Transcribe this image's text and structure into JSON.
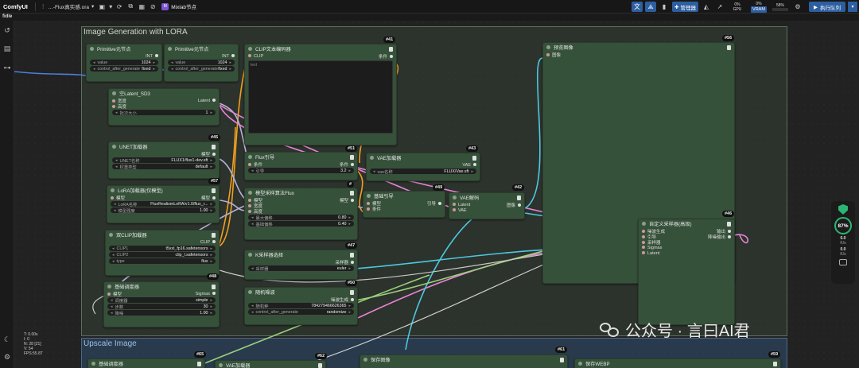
{
  "app": {
    "name": "ComfyUI",
    "workflow_name": "…-Flux真实感.ora",
    "tab_label": "Mixlab节点",
    "subtitle": "fidle"
  },
  "toolbar": {
    "manager_label": "管理器",
    "gpu_label": "GPU",
    "gpu_value": "0%",
    "vram_label": "VRAM",
    "vram_value": "58%",
    "cpu_value": "0%",
    "queue_label": "执行队列"
  },
  "stats": [
    "T: 0.00s",
    "I: 0",
    "N: 28 [21]",
    "V: 54",
    "FPS:55.87"
  ],
  "groups": {
    "main": {
      "title": "Image Generation with LORA"
    },
    "upscale": {
      "title": "Upscale Image"
    }
  },
  "nodes": {
    "primitive1": {
      "title": "Primitive元节点",
      "out": "INT",
      "value_label": "value",
      "value": "1024",
      "cag_label": "control_after_generate",
      "cag_value": "fixed"
    },
    "primitive2": {
      "title": "Primitive元节点",
      "out": "INT",
      "value_label": "value",
      "value": "1024",
      "cag_label": "control_after_generate",
      "cag_value": "fixed"
    },
    "clip_text": {
      "title": "CLIP文本编码器",
      "badge": "#41",
      "in": "CLIP",
      "out": "条件",
      "text": "text"
    },
    "latent": {
      "title": "空Latent_SD3",
      "badge": "#",
      "in1": "宽度",
      "in2": "高度",
      "out": "Latent",
      "w_label": "批次大小",
      "w_value": "1"
    },
    "unet": {
      "title": "UNET加载器",
      "badge": "#45",
      "out": "模型",
      "w1_label": "UNET名称",
      "w1_value": "FLUX1/flux1-dev.sft",
      "w2_label": "权重类型",
      "w2_value": "default"
    },
    "lora": {
      "title": "LoRA加载器(仅模型)",
      "badge": "#57",
      "in": "模型",
      "out": "模型",
      "w1_label": "LoRA名称",
      "w1_value": "FluxRealismLoRA/v1.0/flux_r...",
      "w2_label": "模型强度",
      "w2_value": "1.00"
    },
    "dualclip": {
      "title": "双CLIP加载器",
      "badge": "#48",
      "out": "CLIP",
      "w1_label": "CLIP1",
      "w1_value": "t5xxl_fp16.safetensors",
      "w2_label": "CLIP2",
      "w2_value": "clip_l.safetensors",
      "w3_label": "type",
      "w3_value": "flux"
    },
    "basic_sched": {
      "title": "基础调度器",
      "in": "模型",
      "out": "Sigmas",
      "w1_label": "调度器",
      "w1_value": "simple",
      "w2_label": "步数",
      "w2_value": "30",
      "w3_label": "降噪",
      "w3_value": "1.00"
    },
    "flux_guidance": {
      "title": "Flux引导",
      "badge": "#51",
      "in": "条件",
      "out": "条件",
      "w_label": "引导",
      "w_value": "3.2"
    },
    "model_sample_flux": {
      "title": "模型采样算法Flux",
      "badge": "#",
      "in1": "模型",
      "in2": "宽度",
      "in3": "高度",
      "out": "模型",
      "w1_label": "最大偏移",
      "w1_value": "0.80",
      "w2_label": "基础偏移",
      "w2_value": "0.40"
    },
    "ksampler_select": {
      "title": "K采样器选择",
      "badge": "#47",
      "out": "采样器",
      "w_label": "采样器",
      "w_value": "euler"
    },
    "random_noise": {
      "title": "随机噪波",
      "badge": "#50",
      "out": "噪波生成",
      "w1_label": "随机种",
      "w1_value": "784279466626365",
      "w2_label": "control_after_generate",
      "w2_value": "randomize"
    },
    "vae_loader": {
      "title": "VAE加载器",
      "badge": "#43",
      "out": "VAE",
      "w_label": "vae名称",
      "w_value": "FLUX/Vae.sft"
    },
    "basic_guider": {
      "title": "基础引导",
      "badge": "#49",
      "in1": "模型",
      "in2": "条件",
      "out": "引导"
    },
    "vae_decode": {
      "title": "VAE解码",
      "badge": "#42",
      "in1": "Latent",
      "in2": "VAE",
      "out": "图像"
    },
    "preview": {
      "title": "预览图像",
      "badge": "#56",
      "in": "图像"
    },
    "custom_sampler": {
      "title": "自定义采样器(高级)",
      "badge": "#46",
      "in1": "噪波生成",
      "in2": "引导",
      "in3": "采样器",
      "in4": "Sigmas",
      "in5": "Latent",
      "out1": "输出",
      "out2": "降噪输出"
    },
    "up_sched": {
      "title": "基础调度器",
      "badge": "#65"
    },
    "up_vae": {
      "title": "VAE加载器",
      "badge": "#62"
    },
    "up_save": {
      "title": "保存图像",
      "badge": "#61"
    },
    "up_webp": {
      "title": "保存WEBP",
      "badge": "#59"
    }
  },
  "widget": {
    "percent": "87%",
    "up_value": "0.0",
    "up_unit": "K/s",
    "down_value": "0.0",
    "down_unit": "K/s"
  },
  "watermark": {
    "text": "公众号 · 言曰AI君"
  },
  "colors": {
    "node_body": "#36513a",
    "accent": "#2d5ea0",
    "wire_orange": "#f0a020",
    "wire_pink": "#e985d6",
    "wire_cyan": "#4cc9e0",
    "wire_blue": "#4a7fd8",
    "status_green": "#2bb673"
  }
}
